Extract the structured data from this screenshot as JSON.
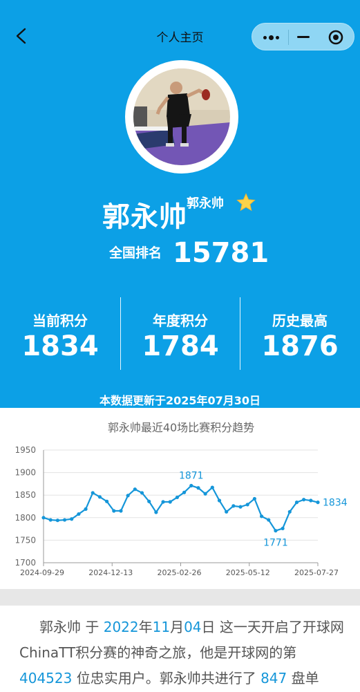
{
  "nav": {
    "title": "个人主页",
    "back_icon": "chevron-left-icon",
    "more_icon": "more-dots-icon",
    "minimize_icon": "minus-icon",
    "close_icon": "target-circle-icon"
  },
  "profile": {
    "name": "郭永帅",
    "nickname": "郭永帅",
    "badge_icon": "star-icon",
    "rank_label": "全国排名",
    "rank_value": "15781"
  },
  "stats": [
    {
      "label": "当前积分",
      "value": "1834"
    },
    {
      "label": "年度积分",
      "value": "1784"
    },
    {
      "label": "历史最高",
      "value": "1876"
    }
  ],
  "update_note": "本数据更新于2025年07月30日",
  "colors": {
    "header_blue": "#0ca0e6",
    "line_blue": "#1596d9",
    "text_gray": "#555555"
  },
  "chart_data": {
    "type": "line",
    "title": "郭永帅最近40场比赛积分趋势",
    "xlabel": "",
    "ylabel": "",
    "ylim": [
      1700,
      1950
    ],
    "yticks": [
      "1950",
      "1900",
      "1850",
      "1800",
      "1750",
      "1700"
    ],
    "xticks": [
      "2024-09-29",
      "2024-12-13",
      "2025-02-26",
      "2025-05-12",
      "2025-07-27"
    ],
    "grid": true,
    "series": [
      {
        "values": [
          1800,
          1795,
          1794,
          1795,
          1797,
          1808,
          1819,
          1855,
          1846,
          1836,
          1815,
          1815,
          1849,
          1863,
          1855,
          1836,
          1812,
          1835,
          1835,
          1845,
          1856,
          1871,
          1866,
          1853,
          1867,
          1838,
          1813,
          1826,
          1824,
          1829,
          1842,
          1803,
          1795,
          1771,
          1776,
          1813,
          1834,
          1840,
          1838,
          1834
        ]
      }
    ],
    "annotations": [
      {
        "text": "1871",
        "index": 21
      },
      {
        "text": "1771",
        "index": 33
      },
      {
        "text": "1834",
        "index": 39
      }
    ]
  },
  "bio": {
    "name": "郭永帅",
    "t1": " 于 ",
    "year": "2022",
    "t2": "年",
    "month": "11",
    "t3": "月",
    "day": "04",
    "t4": "日 这一天开启了开球网ChinaTT积分赛的神奇之旅，他是开球网的第",
    "user_no": "404523",
    "t5": " 位忠实用户。郭永帅共进行了 ",
    "matches": "847",
    "t6": " 盘单"
  }
}
